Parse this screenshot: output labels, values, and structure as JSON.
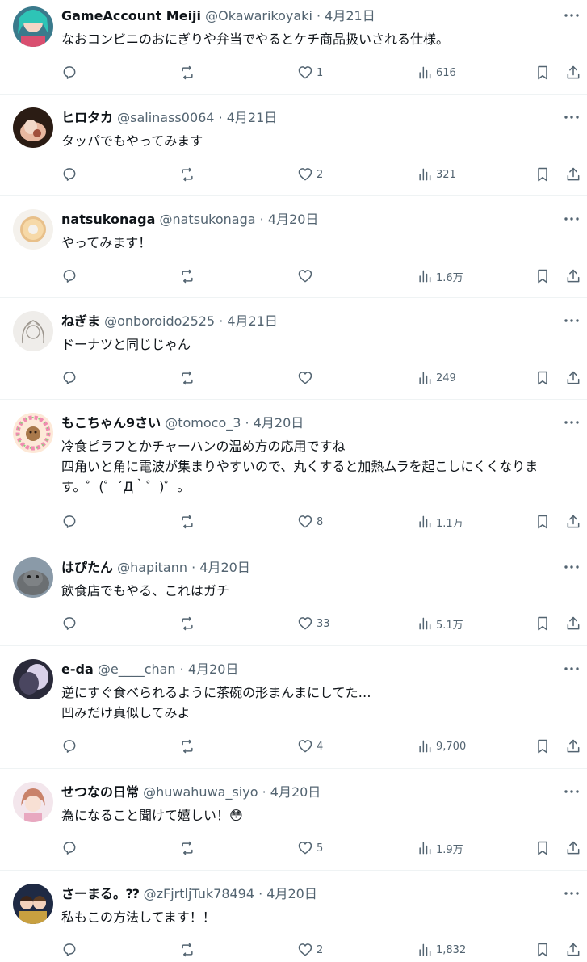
{
  "tweets": [
    {
      "name": "GameAccount Meiji",
      "handle": "@Okawarikoyaki",
      "date": "4月21日",
      "text": "なおコンビニのおにぎりや弁当でやるとケチ商品扱いされる仕様。",
      "likes": "1",
      "views": "616",
      "avatar": "teal-hair-character"
    },
    {
      "name": "ヒロタカ",
      "handle": "@salinass0064",
      "date": "4月21日",
      "text": "タッパでもやってみます",
      "likes": "2",
      "views": "321",
      "avatar": "food-dish"
    },
    {
      "name": "natsukonaga",
      "handle": "@natsukonaga",
      "date": "4月20日",
      "text": "やってみます！",
      "likes": "",
      "views": "1.6万",
      "avatar": "donut"
    },
    {
      "name": "ねぎま",
      "handle": "@onboroido2525",
      "date": "4月21日",
      "text": "ドーナツと同じじゃん",
      "likes": "",
      "views": "249",
      "avatar": "sketch-girl"
    },
    {
      "name": "もこちゃん9さい",
      "handle": "@tomoco_3",
      "date": "4月20日",
      "text": "冷食ピラフとかチャーハンの温め方の応用ですね\n四角いと角に電波が集まりやすいので、丸くすると加熱ムラを起こしにくくなります。゜(゜´Д｀゜)゜。",
      "likes": "8",
      "views": "1.1万",
      "avatar": "flower-wreath"
    },
    {
      "name": "はぴたん",
      "handle": "@hapitann",
      "date": "4月20日",
      "text": "飲食店でもやる、これはガチ",
      "likes": "33",
      "views": "5.1万",
      "avatar": "seal"
    },
    {
      "name": "e-da",
      "handle": "@e____chan",
      "date": "4月20日",
      "text": "逆にすぐ食べられるように茶碗の形まんまにしてた…\n凹みだけ真似してみよ",
      "likes": "4",
      "views": "9,700",
      "avatar": "dark-photo"
    },
    {
      "name": "せつなの日常",
      "handle": "@huwahuwa_siyo",
      "date": "4月20日",
      "text": "為になること聞けて嬉しい！😳",
      "likes": "5",
      "views": "1.9万",
      "avatar": "pink-anime"
    },
    {
      "name": "さーまる。⁇",
      "handle": "@zFjrtljTuk78494",
      "date": "4月20日",
      "text": "私もこの方法してます！！",
      "likes": "2",
      "views": "1,832",
      "avatar": "anime-duo"
    }
  ]
}
